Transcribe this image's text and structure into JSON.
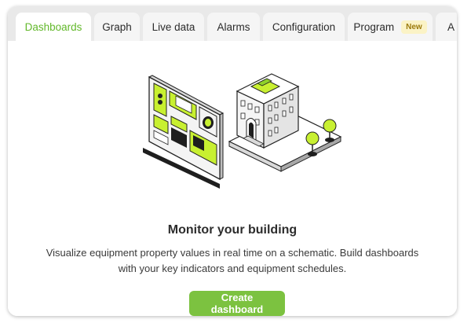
{
  "tabs": [
    {
      "label": "Dashboards",
      "active": true
    },
    {
      "label": "Graph"
    },
    {
      "label": "Live data"
    },
    {
      "label": "Alarms"
    },
    {
      "label": "Configuration"
    },
    {
      "label": "Program",
      "badge": "New"
    },
    {
      "label": "A"
    }
  ],
  "empty_state": {
    "title": "Monitor your building",
    "description": "Visualize equipment property values in real time on a schematic. Build dashboards with your key indicators and equipment schedules.",
    "button_label": "Create dashboard"
  },
  "colors": {
    "accent": "#7cc240",
    "active_tab_text": "#62b82a",
    "illustration_lime": "#c8f031",
    "badge_bg": "#fbf3c6"
  }
}
